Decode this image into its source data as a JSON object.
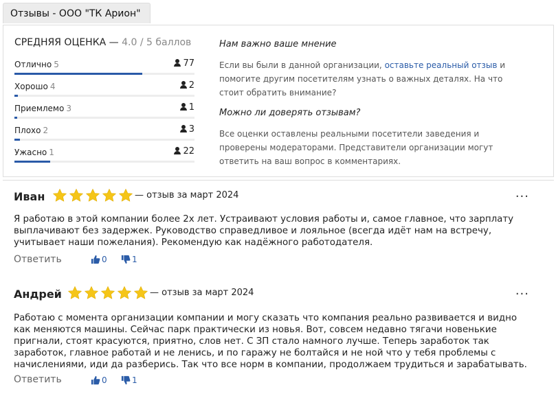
{
  "tab": {
    "title": "Отзывы - ООО \"ТК Арион\""
  },
  "summary": {
    "title_prefix": "СРЕДНЯЯ ОЦЕНКА — ",
    "score": "4.0 / 5 баллов",
    "ratings": [
      {
        "label": "Отлично",
        "num": "5",
        "count": "77",
        "fraction": 0.71
      },
      {
        "label": "Хорошо",
        "num": "4",
        "count": "2",
        "fraction": 0.02
      },
      {
        "label": "Приемлемо",
        "num": "3",
        "count": "1",
        "fraction": 0.01
      },
      {
        "label": "Плохо",
        "num": "2",
        "count": "3",
        "fraction": 0.03
      },
      {
        "label": "Ужасно",
        "num": "1",
        "count": "22",
        "fraction": 0.2
      }
    ]
  },
  "info": {
    "heading1": "Нам важно ваше мнение",
    "p1_before": "Если вы были в данной организации, ",
    "p1_link": "оставьте реальный отзыв",
    "p1_after": " и помогите другим посетителям узнать о важных деталях. На что стоит обратить внимание?",
    "heading2": "Можно ли доверять отзывам?",
    "p2": "Все оценки оставлены реальными посетители заведения и проверены модераторами. Представители организации могут ответить на ваш вопрос в комментариях."
  },
  "reviews": [
    {
      "author": "Иван",
      "stars": 5,
      "date": "— отзыв за март 2024",
      "text": "Я работаю в этой компании более 2х лет. Устраивают условия работы и, самое главное, что зарплату выплачивают без задержек. Руководство справедливое и лояльное (всегда идёт нам на встречу, учитывает наши пожелания). Рекомендую как надёжного работодателя.",
      "reply": "Ответить",
      "likes": "0",
      "dislikes": "1",
      "more": "..."
    },
    {
      "author": "Андрей",
      "stars": 5,
      "date": "— отзыв за март 2024",
      "text": "Работаю с момента организации компании и могу сказать что компания реально развивается и видно как меняются машины. Сейчас парк практически из новья. Вот, совсем недавно тягачи новенькие пригнали, стоят красуются, приятно, слов нет. С ЗП стало намного лучше. Теперь заработок так заработок, главное работай и не ленись, и по гаражу не болтайся и не ной что у тебя проблемы с начислениями, иди да разберись. Так что все норм в компании, продолжаем трудиться и зарабатывать.",
      "reply": "Ответить",
      "likes": "0",
      "dislikes": "1",
      "more": "..."
    }
  ],
  "colors": {
    "accent": "#2a5aa8",
    "star": "#f5c518",
    "link": "#2b5ca8"
  },
  "icons": {
    "user": "person-icon",
    "star": "star-icon",
    "like": "thumb-up-icon",
    "dislike": "thumb-down-icon",
    "more": "more-dots-icon"
  }
}
